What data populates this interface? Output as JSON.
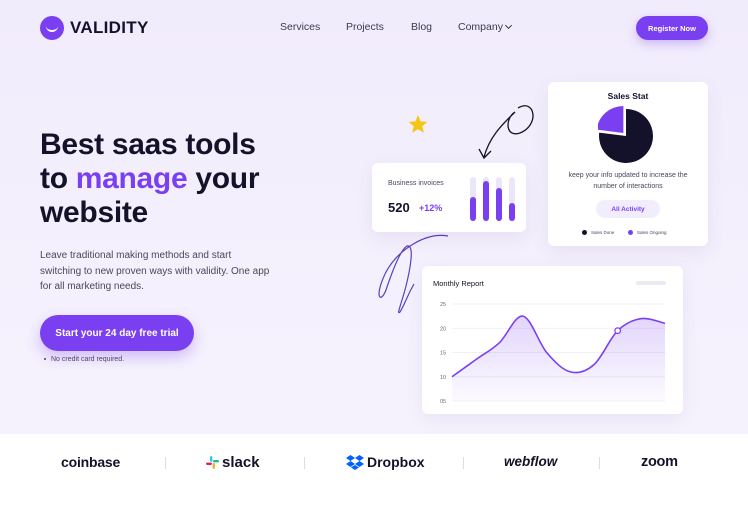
{
  "nav": {
    "brand": "VALIDITY",
    "links": [
      "Services",
      "Projects",
      "Blog",
      "Company"
    ],
    "register_label": "Register Now"
  },
  "hero": {
    "headline_line1": "Best saas tools",
    "headline_line2_pre": "to ",
    "headline_line2_accent": "manage",
    "headline_line2_post": " your",
    "headline_line3": "website",
    "subtext": "Leave traditional making methods and start switching to new proven ways with validity. One app for all marketing needs.",
    "cta_label": "Start your 24 day free trial",
    "note": "No credit card required."
  },
  "invoice_card": {
    "title": "Business invoices",
    "value": "520",
    "change": "+12%",
    "bars": [
      0.55,
      0.9,
      0.75,
      0.4
    ]
  },
  "sales_card": {
    "title": "Sales Stat",
    "description": "keep your info updated to increase the number of interactions",
    "button_label": "All Activity",
    "legend": [
      {
        "label": "Sales Done",
        "color": "#14112a"
      },
      {
        "label": "Sales Ongoing",
        "color": "#7b3ff2"
      }
    ],
    "slices": [
      {
        "name": "Sales Done",
        "value": 77,
        "color": "#14112a"
      },
      {
        "name": "Sales Ongoing",
        "value": 23,
        "color": "#7b3ff2"
      }
    ]
  },
  "report_card": {
    "title": "Monthly Report"
  },
  "chart_data": {
    "type": "area",
    "title": "Monthly Report",
    "ylim": [
      5,
      25
    ],
    "yticks": [
      "25",
      "20",
      "15",
      "10",
      "05"
    ],
    "x": [
      0,
      1,
      2,
      3,
      4,
      5,
      6,
      7,
      8,
      9
    ],
    "series": [
      {
        "values": [
          10,
          13.5,
          17,
          22.5,
          15,
          11,
          12.5,
          19.5,
          22,
          21
        ],
        "color": "#7b3ff2"
      }
    ],
    "highlight_index": 7,
    "grid": true
  },
  "brands": [
    "coinbase",
    "slack",
    "Dropbox",
    "webflow",
    "zoom"
  ],
  "colors": {
    "accent": "#7b3ff2",
    "dark": "#14112a",
    "star": "#f5c518"
  }
}
